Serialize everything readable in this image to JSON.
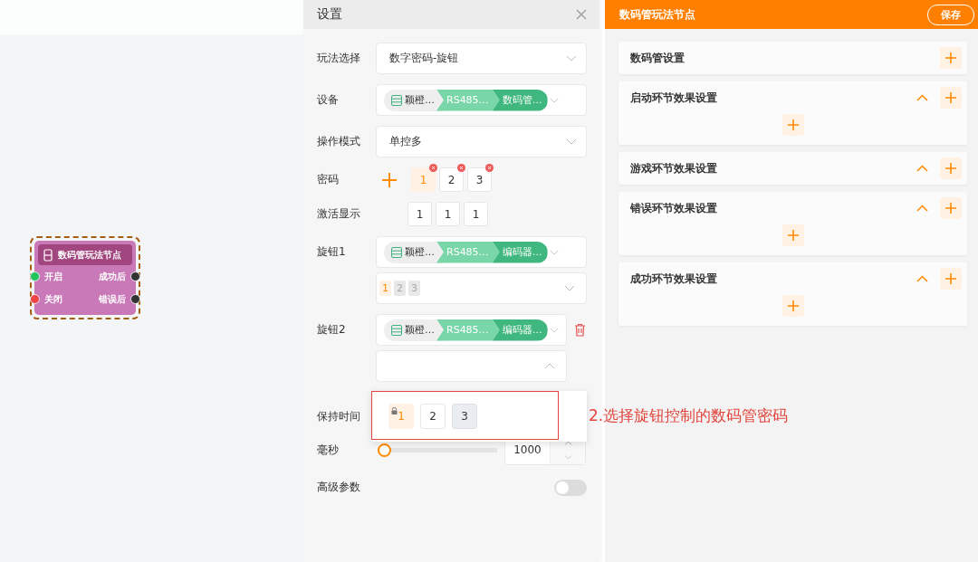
{
  "canvas": {
    "node": {
      "title": "数码管玩法节点",
      "selected": true,
      "inputs": [
        {
          "label": "开启",
          "color": "#22c55e"
        },
        {
          "label": "关闭",
          "color": "#ef4444"
        }
      ],
      "outputs": [
        {
          "label": "成功后",
          "color": "#333333"
        },
        {
          "label": "错误后",
          "color": "#333333"
        }
      ]
    }
  },
  "settings": {
    "title": "设置",
    "fields": [
      {
        "kind": "select",
        "label": "玩法选择",
        "value": "数字密码-旋钮"
      },
      {
        "kind": "device",
        "label": "设备",
        "chips": [
          "颖橙…",
          "RS485…",
          "数码管…"
        ]
      },
      {
        "kind": "select",
        "label": "操作模式",
        "value": "单控多"
      },
      {
        "kind": "code",
        "label": "密码",
        "digits": [
          {
            "text": "1",
            "selected": true
          },
          {
            "text": "2",
            "selected": false
          },
          {
            "text": "3",
            "selected": false
          }
        ]
      },
      {
        "kind": "display",
        "label": "激活显示",
        "digits": [
          "1",
          "1",
          "1"
        ]
      },
      {
        "kind": "knob",
        "label": "旋钮1",
        "chips": [
          "颖橙…",
          "RS485…",
          "编码器…"
        ],
        "deletable": false,
        "open": false,
        "tags": [
          {
            "text": "1",
            "selected": true
          },
          {
            "text": "2",
            "selected": false
          },
          {
            "text": "3",
            "selected": false
          }
        ]
      },
      {
        "kind": "knob",
        "label": "旋钮2",
        "chips": [
          "颖橙…",
          "RS485…",
          "编码器…"
        ],
        "deletable": true,
        "open": true
      },
      {
        "kind": "text",
        "label": "保持时间"
      },
      {
        "kind": "slider",
        "label": "毫秒",
        "level": 0,
        "value": "1000"
      },
      {
        "kind": "toggle",
        "label": "高级参数",
        "on": false
      }
    ],
    "dropdown": {
      "options": [
        {
          "text": "1",
          "locked": true,
          "selected": true,
          "hovered": false
        },
        {
          "text": "2",
          "locked": false,
          "selected": false,
          "hovered": false
        },
        {
          "text": "3",
          "locked": false,
          "selected": false,
          "hovered": true
        }
      ]
    },
    "annotation": "2.选择旋钮控制的数码管密码"
  },
  "panel": {
    "title": "数码管玩法节点",
    "save": "保存",
    "sections": [
      {
        "title": "数码管设置",
        "kind": "plain",
        "add_row": false
      },
      {
        "title": "启动环节效果设置",
        "kind": "collapsible",
        "add_row": true
      },
      {
        "title": "游戏环节效果设置",
        "kind": "collapsible",
        "add_row": false
      },
      {
        "title": "错误环节效果设置",
        "kind": "collapsible",
        "add_row": true
      },
      {
        "title": "成功环节效果设置",
        "kind": "collapsible",
        "add_row": true
      }
    ]
  }
}
